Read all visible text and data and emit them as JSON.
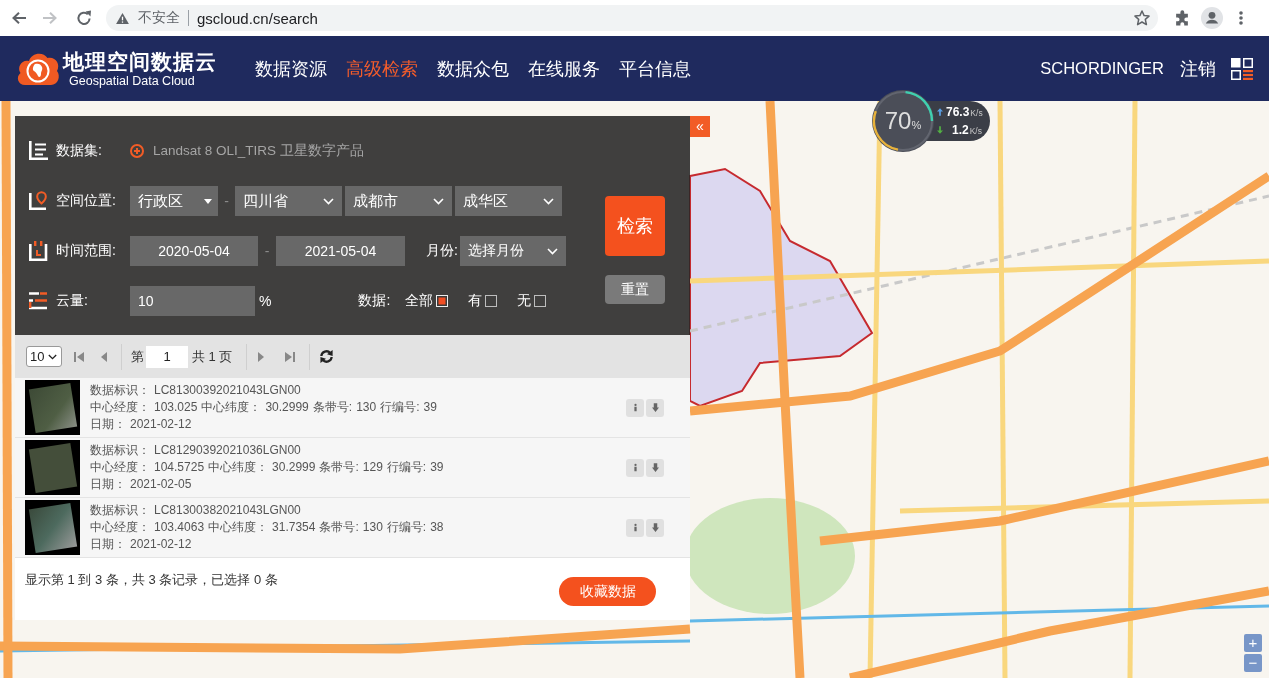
{
  "browser": {
    "forward_disabled": true,
    "security_label": "不安全",
    "url": "gscloud.cn/search"
  },
  "header": {
    "logo_title": "地理空间数据云",
    "logo_subtitle": "Geospatial Data Cloud",
    "nav": [
      {
        "label": "数据资源",
        "selected": false
      },
      {
        "label": "高级检索",
        "selected": true
      },
      {
        "label": "数据众包",
        "selected": false
      },
      {
        "label": "在线服务",
        "selected": false
      },
      {
        "label": "平台信息",
        "selected": false
      }
    ],
    "user": "SCHORDINGER",
    "logout": "注销"
  },
  "speed_widget": {
    "percent": "70",
    "percent_unit": "%",
    "upload": "76.3",
    "upload_unit": "K/s",
    "download": "1.2",
    "download_unit": "K/s"
  },
  "collapse_button": "«",
  "search_panel": {
    "dataset": {
      "label": "数据集:",
      "value": "Landsat 8 OLI_TIRS 卫星数字产品"
    },
    "location": {
      "label": "空间位置:",
      "mode": "行政区",
      "separator": "-",
      "selects": [
        "四川省",
        "成都市",
        "成华区"
      ]
    },
    "time": {
      "label": "时间范围:",
      "start": "2020-05-04",
      "separator": "-",
      "end": "2021-05-04",
      "month_label": "月份:",
      "month": "选择月份"
    },
    "cloud": {
      "label": "云量:",
      "value": "10",
      "unit": "%",
      "data_label": "数据:",
      "options": [
        {
          "label": "全部",
          "checked": true
        },
        {
          "label": "有",
          "checked": false
        },
        {
          "label": "无",
          "checked": false
        }
      ]
    },
    "search_button": "检索",
    "reset_button": "重置"
  },
  "results": {
    "page_size": "10",
    "page_prefix": "第",
    "page": "1",
    "page_total": "共 1 页",
    "rows": [
      {
        "lines": [
          [
            {
              "label": "数据标识：",
              "value": "LC81300392021043LGN00"
            }
          ],
          [
            {
              "label": "中心经度：",
              "value": "103.025"
            },
            {
              "label": "中心纬度：",
              "value": "30.2999"
            },
            {
              "label": "条带号:",
              "value": "130"
            },
            {
              "label": "行编号:",
              "value": "39"
            }
          ],
          [
            {
              "label": "日期：",
              "value": "2021-02-12"
            }
          ]
        ]
      },
      {
        "lines": [
          [
            {
              "label": "数据标识：",
              "value": "LC81290392021036LGN00"
            }
          ],
          [
            {
              "label": "中心经度：",
              "value": "104.5725"
            },
            {
              "label": "中心纬度：",
              "value": "30.2999"
            },
            {
              "label": "条带号:",
              "value": "129"
            },
            {
              "label": "行编号:",
              "value": "39"
            }
          ],
          [
            {
              "label": "日期：",
              "value": "2021-02-05"
            }
          ]
        ]
      },
      {
        "lines": [
          [
            {
              "label": "数据标识：",
              "value": "LC81300382021043LGN00"
            }
          ],
          [
            {
              "label": "中心经度：",
              "value": "103.4063"
            },
            {
              "label": "中心纬度：",
              "value": "31.7354"
            },
            {
              "label": "条带号:",
              "value": "130"
            },
            {
              "label": "行编号:",
              "value": "38"
            }
          ],
          [
            {
              "label": "日期：",
              "value": "2021-02-12"
            }
          ]
        ]
      }
    ],
    "summary": "显示第 1 到 3 条，共 3 条记录，已选择 0 条",
    "collect_button": "收藏数据"
  },
  "zoom": {
    "in": "+",
    "out": "−"
  }
}
